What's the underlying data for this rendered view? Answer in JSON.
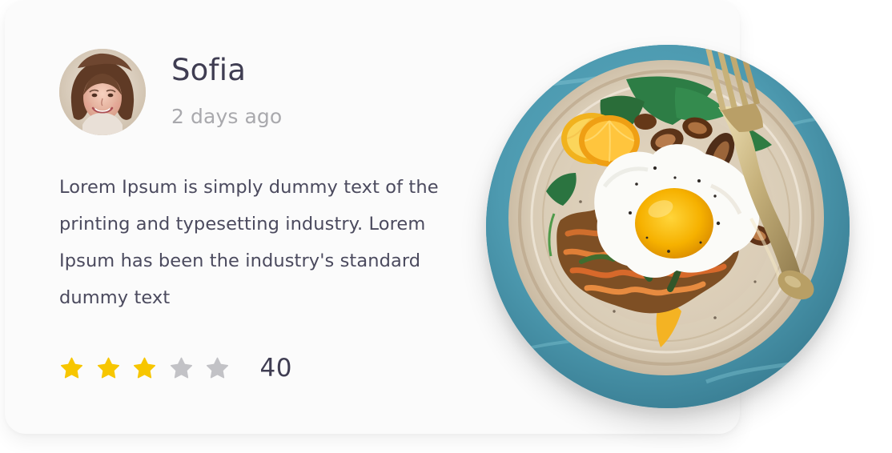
{
  "review": {
    "user_name": "Sofia",
    "posted_time": "2 days ago",
    "body": "Lorem Ipsum is simply dummy text of the printing and typesetting industry. Lorem Ipsum has been the industry's standard dummy text",
    "rating": {
      "filled_stars": 3,
      "total_stars": 5,
      "count": "40"
    }
  },
  "colors": {
    "star_filled": "#f7c600",
    "star_empty": "#c2c2c6",
    "name_text": "#3f3d52",
    "time_text": "#a9a9ad",
    "body_text": "#4b4a5e"
  },
  "icons": {
    "star": "star-icon"
  }
}
